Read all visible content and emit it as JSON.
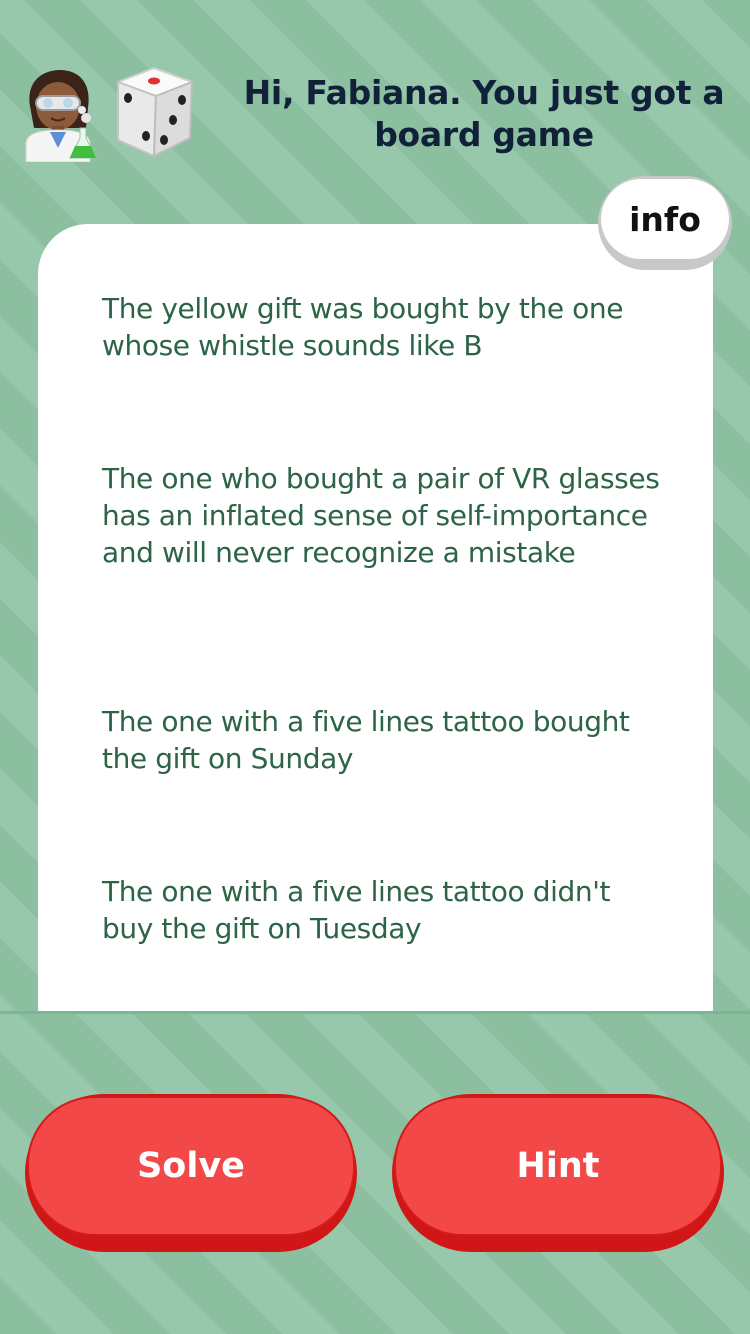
{
  "header": {
    "greeting": "Hi, Fabiana. You just got a board game",
    "avatar_icon": "scientist-woman-icon",
    "dice_icon": "dice-icon"
  },
  "info_button": {
    "label": "info"
  },
  "clues": [
    "The yellow gift was bought by the one whose whistle sounds like B",
    "The one who bought a pair of VR glasses has an inflated sense of self-importance and will never recognize a mistake",
    "The one with a five lines tattoo bought the gift on Sunday",
    "The one with a five lines tattoo didn't buy the gift on Tuesday"
  ],
  "actions": {
    "solve_label": "Solve",
    "hint_label": "Hint"
  },
  "colors": {
    "background": "#8fc1a2",
    "clue_text": "#2d6446",
    "button": "#f34848",
    "button_shadow": "#d01616",
    "title_text": "#12213a"
  }
}
